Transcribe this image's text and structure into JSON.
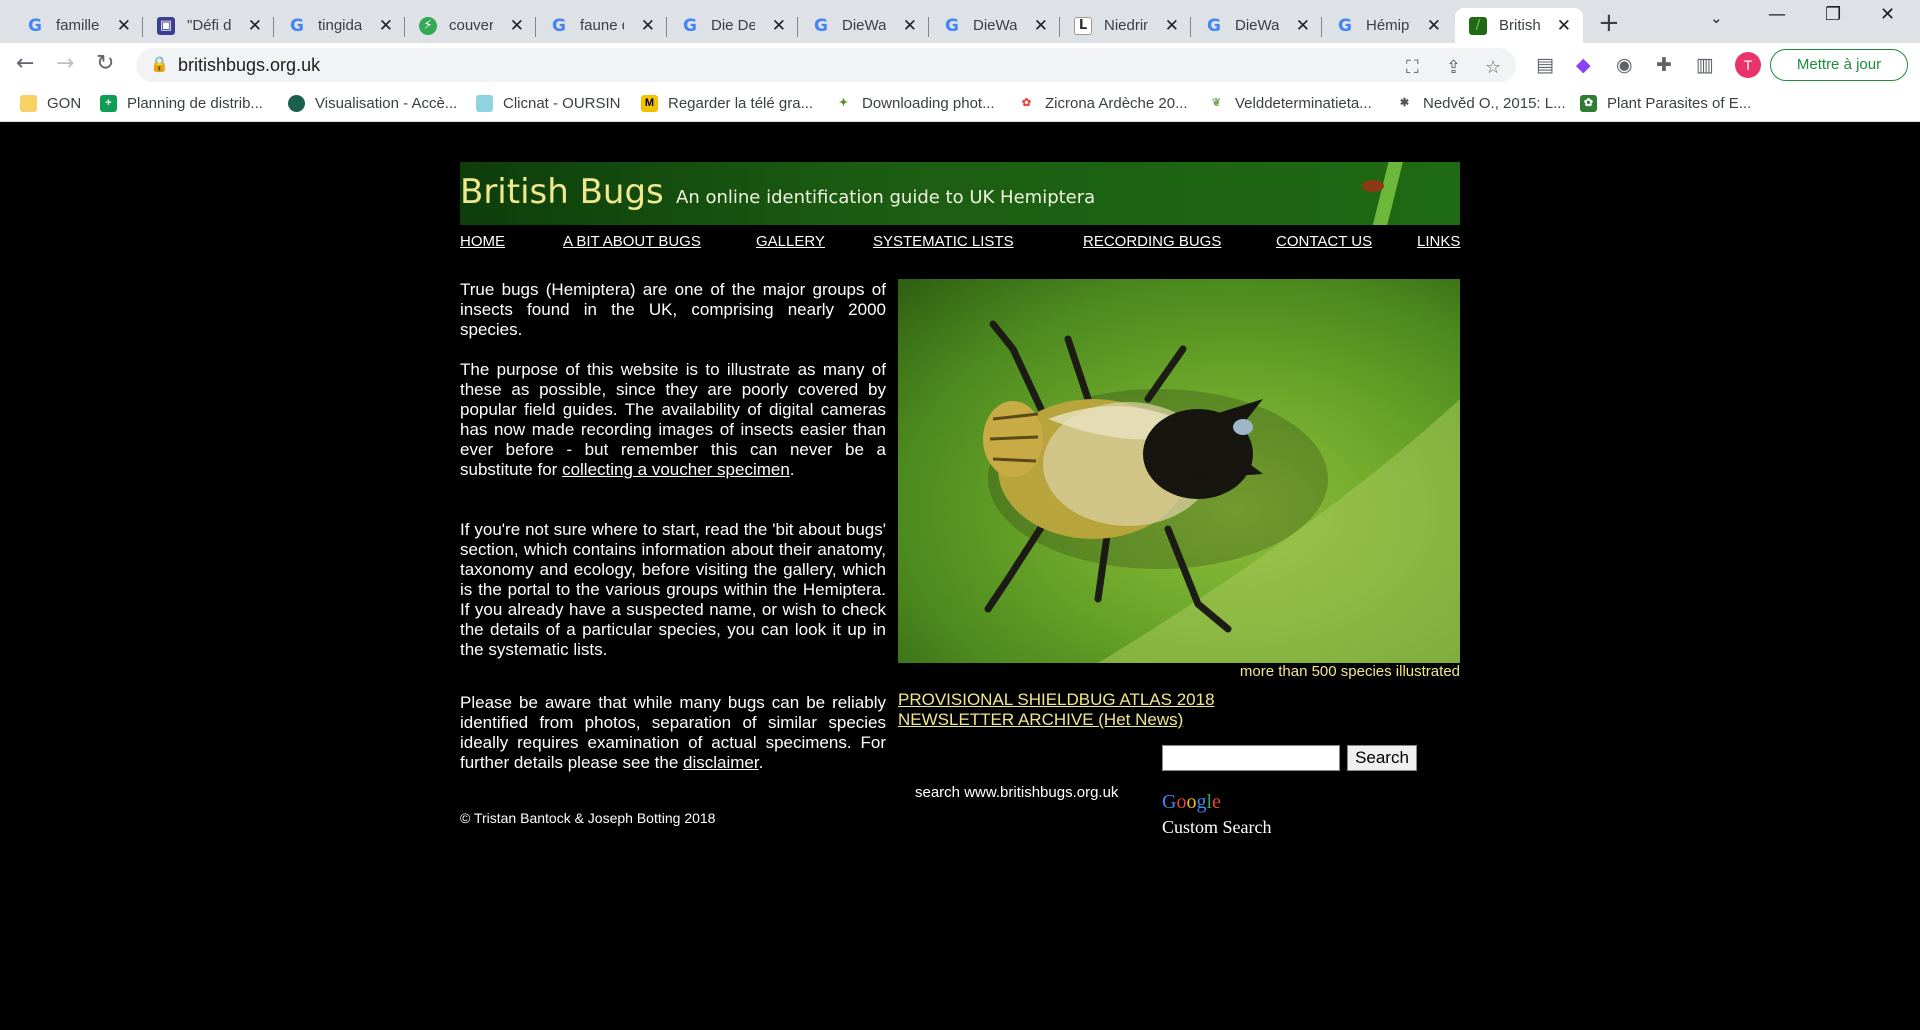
{
  "browser": {
    "tabs": [
      {
        "title": "familles",
        "icon": "google-icon"
      },
      {
        "title": "\"Défi de",
        "icon": "site-icon"
      },
      {
        "title": "tingidae",
        "icon": "google-icon"
      },
      {
        "title": "couvert",
        "icon": "site-icon"
      },
      {
        "title": "faune d",
        "icon": "google-icon"
      },
      {
        "title": "Die Deu",
        "icon": "google-icon"
      },
      {
        "title": "DieWan",
        "icon": "google-icon"
      },
      {
        "title": "DieWan",
        "icon": "google-icon"
      },
      {
        "title": "Niedrin",
        "icon": "site-icon"
      },
      {
        "title": "DieWan",
        "icon": "google-icon"
      },
      {
        "title": "Hémipt",
        "icon": "google-icon"
      },
      {
        "title": "British B",
        "icon": "site-icon"
      }
    ],
    "url": "britishbugs.org.uk",
    "avatar_letter": "T",
    "update_label": "Mettre à jour",
    "bookmarks": [
      "GON",
      "Planning de distrib...",
      "Visualisation - Accè...",
      "Clicnat - OURSIN",
      "Regarder la télé gra...",
      "Downloading phot...",
      "Zicrona Ardèche 20...",
      "Velddeterminatieta...",
      "Nedvěd O., 2015: L...",
      "Plant Parasites of E..."
    ]
  },
  "site": {
    "title": "British Bugs",
    "subtitle": "An online identification guide to UK Hemiptera",
    "nav": [
      "HOME",
      "A BIT ABOUT BUGS",
      "GALLERY",
      "SYSTEMATIC LISTS",
      "RECORDING BUGS",
      "CONTACT US",
      "LINKS"
    ],
    "para1": "True bugs (Hemiptera) are one of the major groups of insects found in the UK, comprising nearly 2000 species.",
    "para2_text": "The purpose of this website is to illustrate as many of these as possible, since they are poorly covered by popular field guides. The availability of digital cameras has now made recording images of insects easier than ever before - but remember this can never be a substitute for ",
    "para2_link": "collecting a voucher specimen",
    "para2_end": ".",
    "para3": "If you're not sure where to start, read the 'bit about bugs' section, which contains information about their anatomy, taxonomy and ecology, before visiting the gallery, which is the portal to the various groups within the Hemiptera. If you already have a suspected name, or wish to check the details of a particular species, you can look it up in the systematic lists.",
    "para4_text": "Please be aware that while many bugs can be reliably identified from photos, separation of similar species ideally requires examination of actual specimens. For further details please see the ",
    "para4_link": "disclaimer",
    "para4_end": ".",
    "copyright": "© Tristan Bantock & Joseph Botting 2018",
    "photo_caption": "more than 500 species illustrated",
    "link_atlas": "PROVISIONAL SHIELDBUG ATLAS 2018",
    "link_newsletter": "NEWSLETTER ARCHIVE (Het News)",
    "search_button": "Search",
    "search_note": "search www.britishbugs.org.uk",
    "google_text": "Google",
    "custom_search": "Custom Search"
  }
}
